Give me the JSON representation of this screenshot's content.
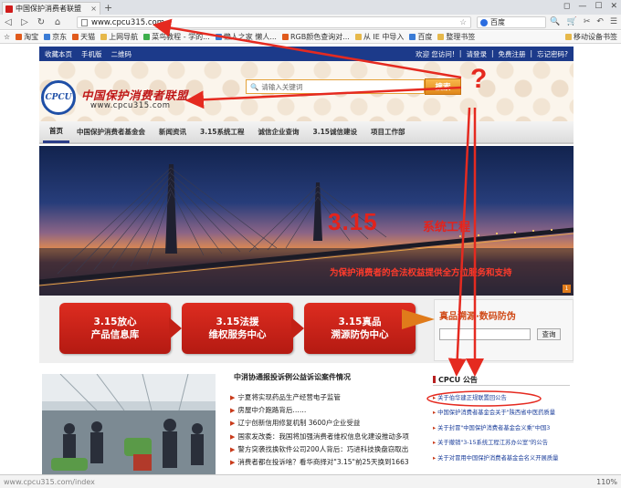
{
  "browser": {
    "tab_title": "中国保护消费者联盟",
    "tab_close": "×",
    "new_tab": "+",
    "url": "www.cpcu315.com",
    "search_engine_label": "百度",
    "window_controls": [
      "◻",
      "—",
      "☐",
      "✕"
    ],
    "nav_buttons": [
      "◁",
      "▷",
      "↻",
      "⌂",
      "‹"
    ],
    "nav_right_icons": [
      "🔍",
      "🛒",
      "✂",
      "↶",
      "☰"
    ],
    "bookmarks": [
      "淘宝",
      "京东",
      "天猫",
      "上网导航",
      "菜鸟教程 - 学的...",
      "懒人之家 懒人...",
      "RGB颜色查询对...",
      "从 IE 中导入",
      "百度",
      "整理书签"
    ],
    "bookmarks_right": "移动设备书签"
  },
  "page": {
    "topstrip_left": [
      "收藏本页",
      "手机版",
      "二维码"
    ],
    "topstrip_right": [
      "欢迎 您访问!",
      "|",
      "请登录",
      "|",
      "免费注册",
      "|",
      "忘记密码?"
    ],
    "logo_mark": "CPCU",
    "logo_name": "中国保护消费者联盟",
    "logo_url": "www.cpcu315.com",
    "search_placeholder": "请输入关键词",
    "search_button": "搜索",
    "nav": [
      "首页",
      "中国保护消费者基金会",
      "新闻资讯",
      "3.15系统工程",
      "诚信企业查询",
      "3.15诚信建设",
      "项目工作部"
    ],
    "banner_big": "3.15",
    "banner_sub": "系统工程",
    "banner_slogan": "为保护消费者的合法权益提供全方位服务和支持",
    "banner_page": "1",
    "features": [
      {
        "line1": "3.15放心",
        "line2": "产品信息库"
      },
      {
        "line1": "3.15法援",
        "line2": "维权服务中心"
      },
      {
        "line1": "3.15真品",
        "line2": "溯源防伪中心"
      }
    ],
    "trace_title": "真品溯源·数码防伪",
    "trace_button": "查询",
    "news_heading": "中消协通报投诉例公益诉讼案件情况",
    "news": [
      "宁夏将实现药品生产经营电子监管",
      "房屋中介跑路背后……",
      "辽宁创新信用修复机制 3600户企业受益",
      "国家发改委：我国将加强消费者维权信息化建设推动多项",
      "警方突袭找换软件公司200人背后：巧进科技换盘窃取出",
      "消费者都在投诉啥？看华商择对\"3.15\"前25天换到1663"
    ],
    "cpcu_heading": "CPCU 公告",
    "cpcu": [
      "关于伯华建正规联置回公告",
      "中国保护消费者基金会关于\"陕西省中医药质量",
      "关于封冒\"中国保护消费者基金会义乘\"中国3",
      "关于撤销\"3-15系统工程江苏办公室\"的公告",
      "关于对冒用中国保护消费者基金会名义开展质量"
    ]
  },
  "statusbar": {
    "url": "www.cpcu315.com/index",
    "zoom": "110%"
  },
  "annotation": {
    "question_mark": "?",
    "arrow_color": "#e52a20"
  }
}
